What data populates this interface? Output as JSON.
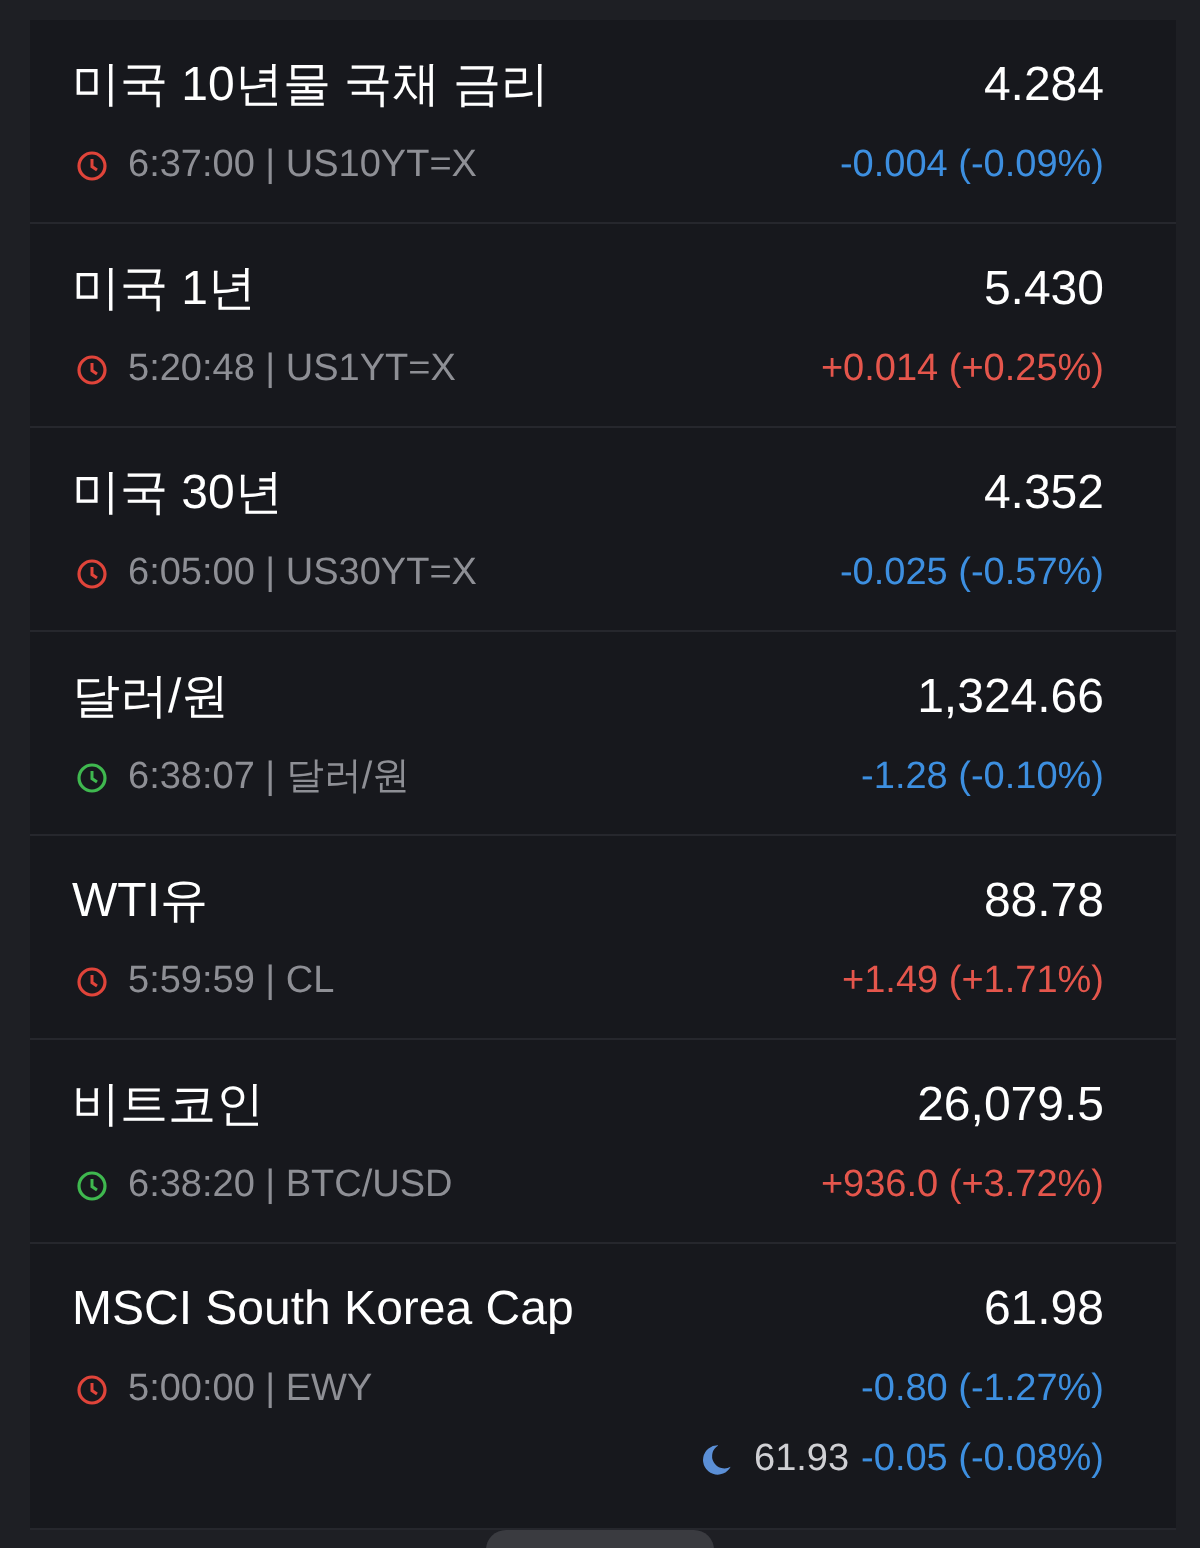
{
  "quotes": [
    {
      "name": "미국 10년물 국채 금리",
      "price": "4.284",
      "info": "6:37:00 | US10YT=X",
      "market_open": false,
      "change": "-0.004 (-0.09%)",
      "rising": false
    },
    {
      "name": "미국 1년",
      "price": "5.430",
      "info": "5:20:48 | US1YT=X",
      "market_open": false,
      "change": "+0.014 (+0.25%)",
      "rising": true
    },
    {
      "name": "미국 30년",
      "price": "4.352",
      "info": "6:05:00 | US30YT=X",
      "market_open": false,
      "change": "-0.025 (-0.57%)",
      "rising": false
    },
    {
      "name": "달러/원",
      "price": "1,324.66",
      "info": "6:38:07 | 달러/원",
      "market_open": true,
      "change": "-1.28 (-0.10%)",
      "rising": false
    },
    {
      "name": "WTI유",
      "price": "88.78",
      "info": "5:59:59 | CL",
      "market_open": false,
      "change": "+1.49 (+1.71%)",
      "rising": true
    },
    {
      "name": "비트코인",
      "price": "26,079.5",
      "info": "6:38:20 | BTC/USD",
      "market_open": true,
      "change": "+936.0 (+3.72%)",
      "rising": true
    },
    {
      "name": "MSCI South Korea Cap",
      "price": "61.98",
      "info": "5:00:00 | EWY",
      "market_open": false,
      "change": "-0.80 (-1.27%)",
      "rising": false,
      "after_hours": {
        "price": "61.93",
        "change": "-0.05 (-0.08%)",
        "rising": false
      }
    }
  ]
}
